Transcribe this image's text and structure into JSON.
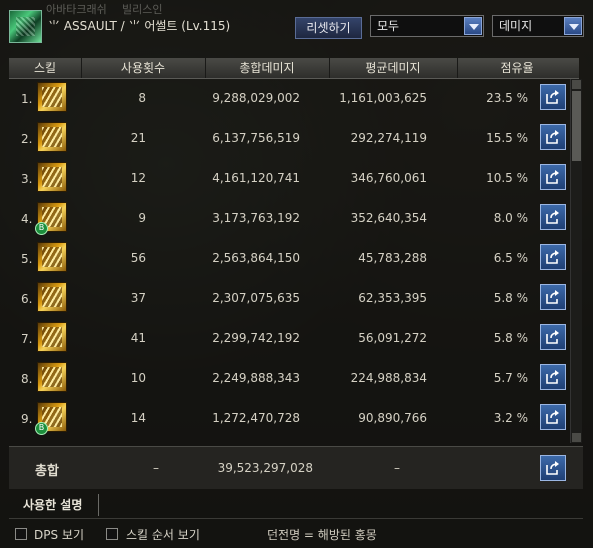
{
  "header": {
    "faded_tabs": [
      "아바타크래쉬",
      "빌리스인"
    ],
    "character_name": "⺌ ASSAULT / ⺌ 어썰트 (Lv.115)",
    "reset_button": "리셋하기",
    "filter_select": "모두",
    "type_select": "데미지"
  },
  "columns": [
    "스킬",
    "사용횟수",
    "총합데미지",
    "평균데미지",
    "점유율"
  ],
  "rows": [
    {
      "num": "1.",
      "uses": "8",
      "total": "9,288,029,002",
      "avg": "1,161,003,625",
      "share": "23.5 %",
      "badge": false
    },
    {
      "num": "2.",
      "uses": "21",
      "total": "6,137,756,519",
      "avg": "292,274,119",
      "share": "15.5 %",
      "badge": false
    },
    {
      "num": "3.",
      "uses": "12",
      "total": "4,161,120,741",
      "avg": "346,760,061",
      "share": "10.5 %",
      "badge": false
    },
    {
      "num": "4.",
      "uses": "9",
      "total": "3,173,763,192",
      "avg": "352,640,354",
      "share": "8.0 %",
      "badge": true
    },
    {
      "num": "5.",
      "uses": "56",
      "total": "2,563,864,150",
      "avg": "45,783,288",
      "share": "6.5 %",
      "badge": false
    },
    {
      "num": "6.",
      "uses": "37",
      "total": "2,307,075,635",
      "avg": "62,353,395",
      "share": "5.8 %",
      "badge": false
    },
    {
      "num": "7.",
      "uses": "41",
      "total": "2,299,742,192",
      "avg": "56,091,272",
      "share": "5.8 %",
      "badge": false
    },
    {
      "num": "8.",
      "uses": "10",
      "total": "2,249,888,343",
      "avg": "224,988,834",
      "share": "5.7 %",
      "badge": false
    },
    {
      "num": "9.",
      "uses": "14",
      "total": "1,272,470,728",
      "avg": "90,890,766",
      "share": "3.2 %",
      "badge": true
    }
  ],
  "total": {
    "label": "총합",
    "uses": "–",
    "total": "39,523,297,028",
    "avg": "–"
  },
  "badge_letter": "B",
  "bottom": {
    "used_tab": "사용한 설명",
    "dps_checkbox": "DPS 보기",
    "skill_order_checkbox": "스킬 순서 보기",
    "footer_text": "던전명 = 해방된 홍몽"
  },
  "scroll_percent": 20,
  "colors": {
    "accent": "#2b4a86",
    "gold": "#d89a12",
    "badge_green": "#1d8f3d"
  }
}
